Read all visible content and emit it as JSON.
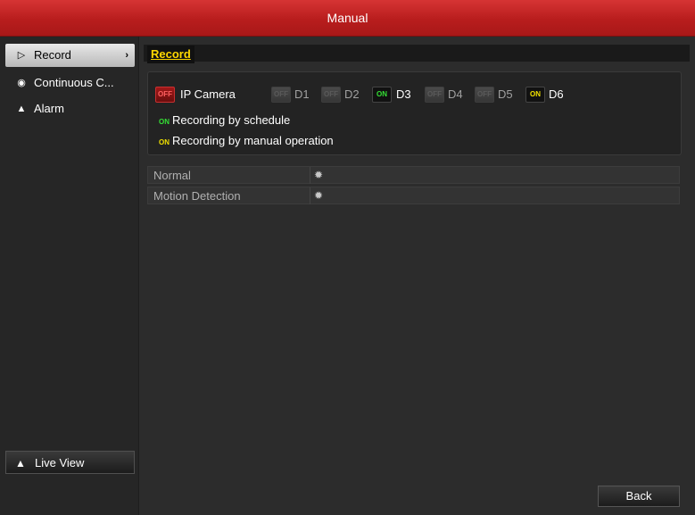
{
  "window": {
    "title": "Manual"
  },
  "sidebar": {
    "items": [
      {
        "label": "Record",
        "icon": "record-icon",
        "active": true
      },
      {
        "label": "Continuous C...",
        "icon": "camera-icon",
        "active": false
      },
      {
        "label": "Alarm",
        "icon": "alarm-icon",
        "active": false
      }
    ],
    "live_view": "Live View"
  },
  "tab": {
    "label": "Record"
  },
  "cameras": {
    "ip_camera": {
      "label": "IP Camera",
      "state": "OFF"
    },
    "channels": [
      {
        "label": "D1",
        "state": "OFF"
      },
      {
        "label": "D2",
        "state": "OFF"
      },
      {
        "label": "D3",
        "state": "ON"
      },
      {
        "label": "D4",
        "state": "OFF"
      },
      {
        "label": "D5",
        "state": "OFF"
      },
      {
        "label": "D6",
        "state": "ON"
      }
    ]
  },
  "legend": {
    "schedule": {
      "tag": "ON",
      "label": "Recording by schedule",
      "color": "#35e035"
    },
    "manual": {
      "tag": "ON",
      "label": "Recording by manual operation",
      "color": "#f0e000"
    }
  },
  "table": {
    "rows": [
      {
        "label": "Normal"
      },
      {
        "label": "Motion Detection"
      }
    ]
  },
  "buttons": {
    "back": "Back"
  },
  "colors": {
    "titlebar": "#c02222",
    "accent_tab": "#ffd800"
  }
}
